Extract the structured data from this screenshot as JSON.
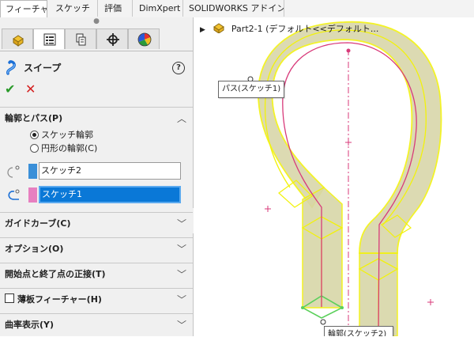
{
  "tabs": [
    {
      "label": "フィーチャー",
      "active": true
    },
    {
      "label": "スケッチ",
      "active": false
    },
    {
      "label": "評価",
      "active": false
    },
    {
      "label": "DimXpert",
      "active": false
    },
    {
      "label": "SOLIDWORKS アドイン",
      "active": false
    }
  ],
  "panel": {
    "icon_tabs": [
      "featuremanager-icon",
      "propertymanager-icon",
      "configurationmanager-icon",
      "dimxpertmanager-icon",
      "displaymanager-icon"
    ],
    "feature_title": "スイープ",
    "help": "?",
    "ok": "✔",
    "cancel": "✕",
    "sections": {
      "profile_path": {
        "title": "輪郭とパス(P)",
        "radio_sketch_profile": "スケッチ輪郭",
        "radio_circular_profile": "円形の輪郭(C)",
        "profile_value": "スケッチ2",
        "path_value": "スケッチ1"
      },
      "guide_curves": "ガイドカーブ(C)",
      "options": "オプション(O)",
      "tangency": "開始点と終了点の正接(T)",
      "thin_feature": "薄板フィーチャー(H)",
      "curvature": "曲率表示(Y)"
    },
    "colors": {
      "profile_swatch": "#3a8fd8",
      "path_swatch": "#e77fc0",
      "selected": "#0a78d7"
    }
  },
  "viewport": {
    "tree_label": "Part2-1 (デフォルト<<デフォルト...",
    "callout_path": "パス(スケッチ1)",
    "callout_profile": "輪郭(スケッチ2)",
    "colors": {
      "sweep_fill": "#d8d6a8",
      "edge": "#f2f20a",
      "sketch": "#d83a7a"
    }
  }
}
